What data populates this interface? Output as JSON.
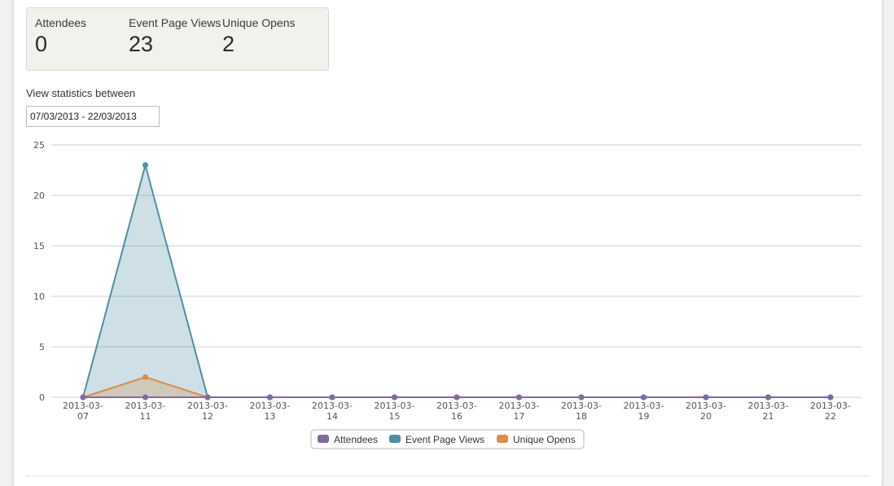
{
  "stats": [
    {
      "label": "Attendees",
      "value": "0"
    },
    {
      "label": "Event Page Views",
      "value": "23"
    },
    {
      "label": "Unique Opens",
      "value": "2"
    }
  ],
  "date_range": {
    "label": "View statistics between",
    "value": "07/03/2013 - 22/03/2013"
  },
  "colors": {
    "attendees": "#7f6b9e",
    "page_views": "#4f8ea4",
    "unique_opens": "#d98c45"
  },
  "chart_data": {
    "type": "area",
    "categories": [
      "2013-03-07",
      "2013-03-11",
      "2013-03-12",
      "2013-03-13",
      "2013-03-14",
      "2013-03-15",
      "2013-03-16",
      "2013-03-17",
      "2013-03-18",
      "2013-03-19",
      "2013-03-20",
      "2013-03-21",
      "2013-03-22"
    ],
    "series": [
      {
        "name": "Attendees",
        "values": [
          0,
          0,
          0,
          0,
          0,
          0,
          0,
          0,
          0,
          0,
          0,
          0,
          0
        ]
      },
      {
        "name": "Event Page Views",
        "values": [
          0,
          23,
          0,
          0,
          0,
          0,
          0,
          0,
          0,
          0,
          0,
          0,
          0
        ]
      },
      {
        "name": "Unique Opens",
        "values": [
          0,
          2,
          0,
          0,
          0,
          0,
          0,
          0,
          0,
          0,
          0,
          0,
          0
        ]
      }
    ],
    "ylim": [
      0,
      25
    ],
    "yticks": [
      0,
      5,
      10,
      15,
      20,
      25
    ],
    "grid": true,
    "legend_position": "bottom-center"
  }
}
